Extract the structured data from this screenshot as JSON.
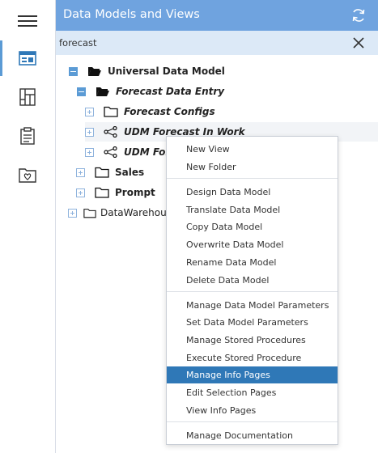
{
  "panel": {
    "title": "Data Models and Views"
  },
  "search": {
    "value": "forecast"
  },
  "tree": {
    "universal_data_model": "Universal Data Model",
    "forecast_data_entry": "Forecast Data Entry",
    "forecast_configs": "Forecast Configs",
    "udm_forecast_in_work": "UDM Forecast In Work",
    "udm_forecast_2": "UDM Forec",
    "sales": "Sales",
    "prompt": "Prompt",
    "datawarehouse": "DataWarehous"
  },
  "context_menu": {
    "items": [
      "New View",
      "New Folder",
      "Design Data Model",
      "Translate Data Model",
      "Copy Data Model",
      "Overwrite Data Model",
      "Rename Data Model",
      "Delete Data Model",
      "Manage Data Model Parameters",
      "Set Data Model Parameters",
      "Manage Stored Procedures",
      "Execute Stored Procedure",
      "Manage Info Pages",
      "Edit Selection Pages",
      "View Info Pages",
      "Manage Documentation"
    ],
    "selected": "Manage Info Pages"
  },
  "colors": {
    "header": "#6fa3df",
    "search_bg": "#dce9f7",
    "accent": "#5b9bd5",
    "selected": "#2f78b7"
  }
}
